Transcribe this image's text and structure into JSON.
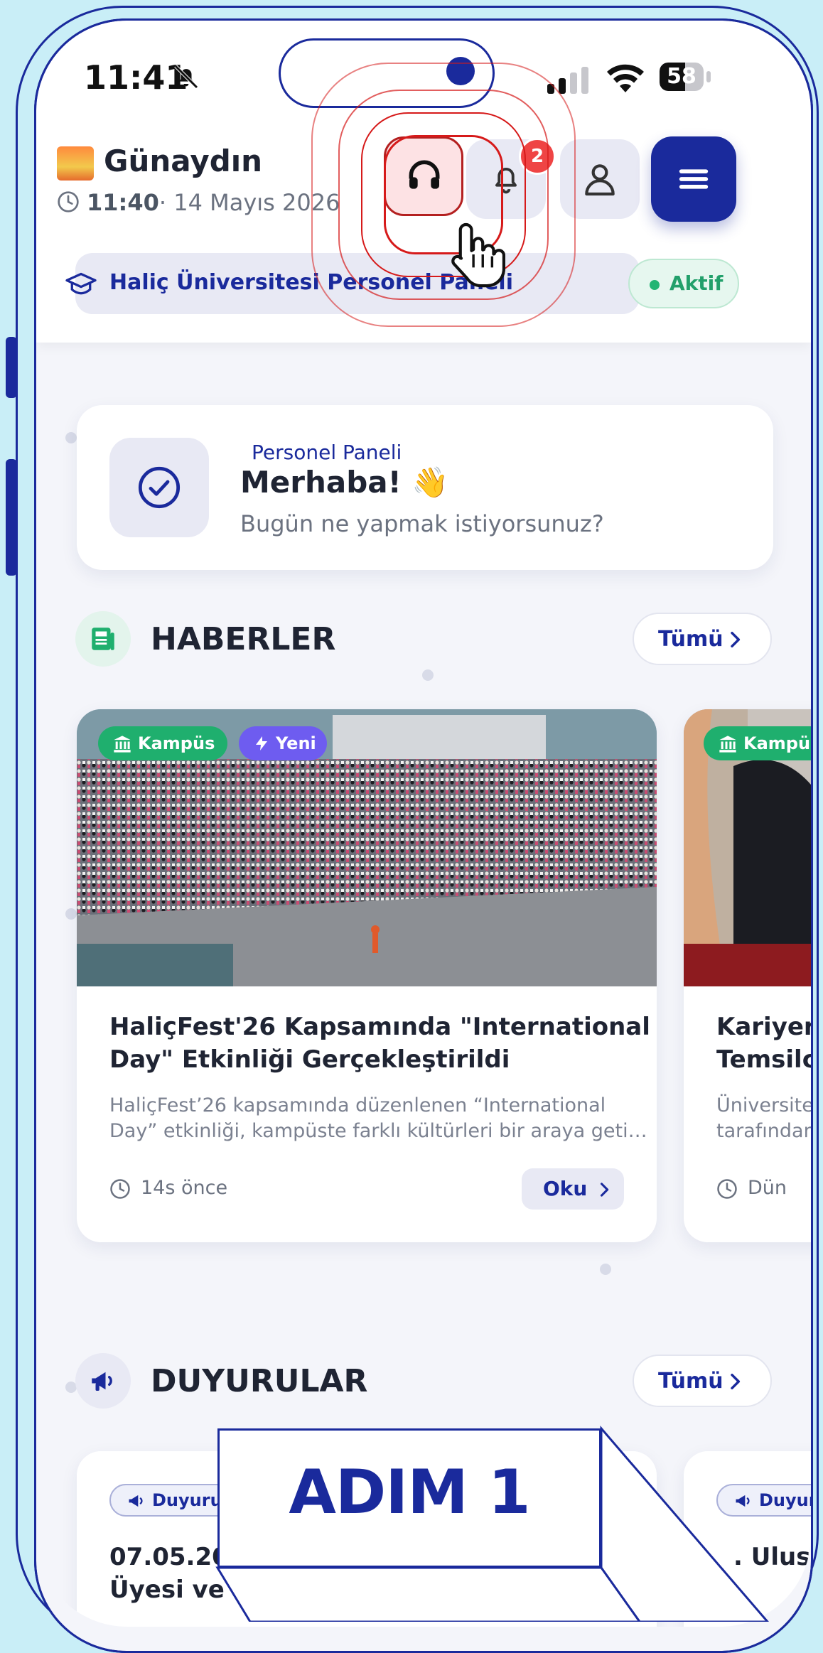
{
  "status_bar": {
    "time": "11:41",
    "battery": "58",
    "battery_level": 0.58
  },
  "header": {
    "greeting": "Günaydın",
    "time": "11:40",
    "date": "· 14 Mayıs 2026",
    "notification_count": "2",
    "panel_label": "Haliç Üniversitesi Personel Paneli",
    "status": "Aktif"
  },
  "hero": {
    "subtitle": "Personel Paneli",
    "title": "Merhaba! 👋",
    "description": "Bugün ne yapmak istiyorsunuz?"
  },
  "news": {
    "title": "HABERLER",
    "all_label": "Tümü",
    "cards": [
      {
        "tag1": "Kampüs",
        "tag2": "Yeni",
        "title_line1": "HaliçFest'26 Kapsamında \"International",
        "title_line2": "Day\" Etkinliği Gerçekleştirildi",
        "desc_line1": "HaliçFest’26 kapsamında düzenlenen “International",
        "desc_line2": "Day” etkinliği, kampüste farklı kültürleri bir araya geti…",
        "time": "14s önce",
        "read_label": "Oku"
      },
      {
        "tag1": "Kampüs",
        "title_line1": "Kariyer",
        "title_line2": "Temsilc",
        "desc_line1": "Üniversite",
        "desc_line2": "tarafından",
        "time": "Dün"
      }
    ]
  },
  "announcements": {
    "title": "DUYURULAR",
    "all_label": "Tümü",
    "cards": [
      {
        "tag": "Duyuru",
        "title_line1": "07.05.20",
        "title_line2": "Üyesi ve Öğ"
      },
      {
        "tag": "Duyur",
        "title_line1": ". Ulus"
      }
    ]
  },
  "overlay": {
    "step_label": "ADIM 1"
  },
  "colors": {
    "brand": "#1a2a9c",
    "accent_red": "#d61a1a",
    "success": "#22b573",
    "tag_green": "#1faf6e",
    "tag_purple": "#6e5cf0"
  }
}
